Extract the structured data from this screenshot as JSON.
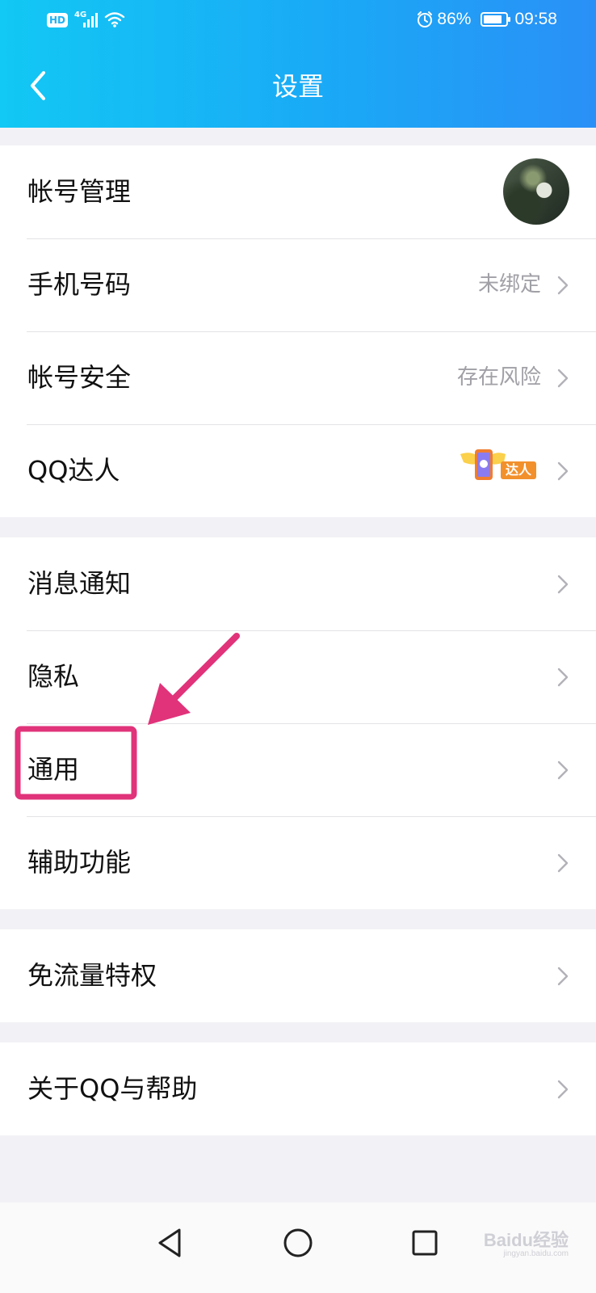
{
  "status_bar": {
    "hd": "HD",
    "network": "4G",
    "battery": "86%",
    "battery_level": 0.86,
    "time": "09:58"
  },
  "header": {
    "title": "设置"
  },
  "groups": {
    "account": {
      "manage": {
        "label": "帐号管理"
      },
      "phone": {
        "label": "手机号码",
        "value": "未绑定"
      },
      "security": {
        "label": "帐号安全",
        "value": "存在风险"
      },
      "daren": {
        "label": "QQ达人",
        "badge": "达人"
      }
    },
    "general": {
      "notify": {
        "label": "消息通知"
      },
      "privacy": {
        "label": "隐私"
      },
      "general": {
        "label": "通用"
      },
      "accessibility": {
        "label": "辅助功能"
      }
    },
    "data": {
      "free_traffic": {
        "label": "免流量特权"
      }
    },
    "about": {
      "help": {
        "label": "关于QQ与帮助"
      }
    }
  },
  "watermark": {
    "brand": "Baidu经验",
    "url": "jingyan.baidu.com"
  },
  "colors": {
    "header_gradient_start": "#12c8f4",
    "header_gradient_end": "#2a90f7",
    "annotation": "#e0337a"
  }
}
